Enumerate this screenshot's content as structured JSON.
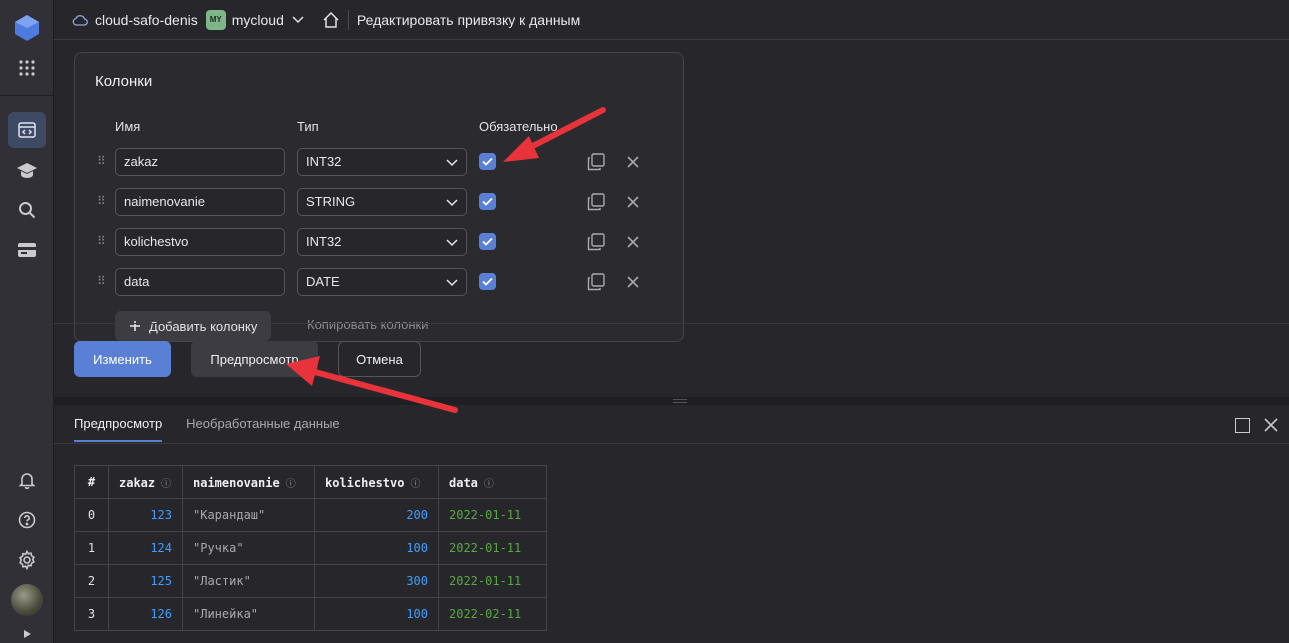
{
  "header": {
    "cloud": "cloud-safo-denis",
    "folder_badge": "MY",
    "folder": "mycloud",
    "page_title": "Редактировать привязку к данным"
  },
  "columns_panel": {
    "title": "Колонки",
    "headers": {
      "name": "Имя",
      "type": "Тип",
      "required": "Обязательно"
    },
    "rows": [
      {
        "name": "zakaz",
        "type": "INT32",
        "required": true
      },
      {
        "name": "naimenovanie",
        "type": "STRING",
        "required": true
      },
      {
        "name": "kolichestvo",
        "type": "INT32",
        "required": true
      },
      {
        "name": "data",
        "type": "DATE",
        "required": true
      }
    ],
    "add_column": "Добавить колонку",
    "copy_columns": "Копировать колонки"
  },
  "actions": {
    "change": "Изменить",
    "preview": "Предпросмотр",
    "cancel": "Отмена"
  },
  "preview_pane": {
    "tabs": [
      "Предпросмотр",
      "Необработанные данные"
    ],
    "active_tab": 0,
    "table": {
      "columns": [
        "#",
        "zakaz",
        "naimenovanie",
        "kolichestvo",
        "data"
      ],
      "rows": [
        [
          "0",
          "123",
          "\"Карандаш\"",
          "200",
          "2022-01-11"
        ],
        [
          "1",
          "124",
          "\"Ручка\"",
          "100",
          "2022-01-11"
        ],
        [
          "2",
          "125",
          "\"Ластик\"",
          "300",
          "2022-01-11"
        ],
        [
          "3",
          "126",
          "\"Линейка\"",
          "100",
          "2022-02-11"
        ]
      ]
    }
  },
  "colors": {
    "accent": "#5a80d6",
    "arrow": "#e8333a",
    "number": "#3f9dff",
    "date": "#57a843"
  }
}
